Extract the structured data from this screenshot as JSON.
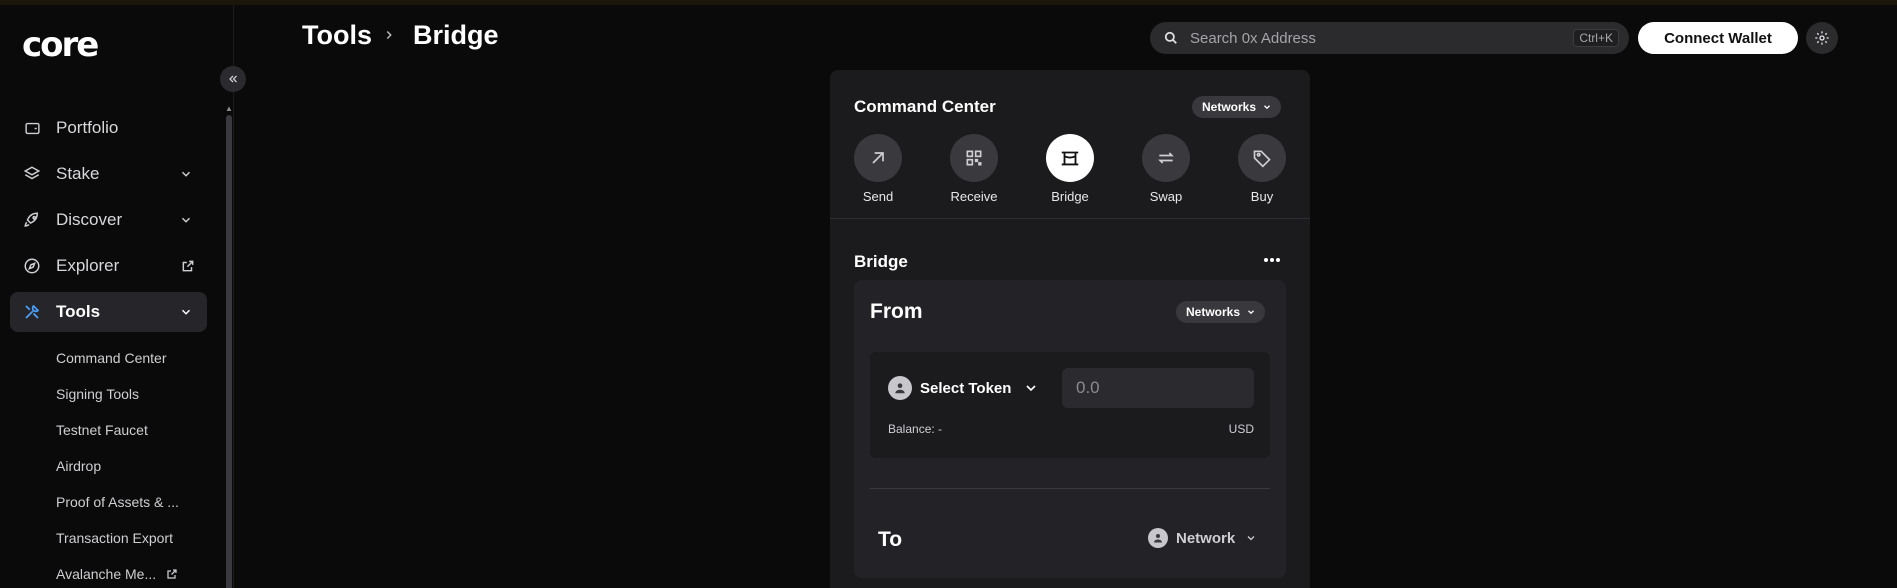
{
  "app": {
    "logo": "core"
  },
  "sidebar": {
    "items": [
      {
        "label": "Portfolio"
      },
      {
        "label": "Stake"
      },
      {
        "label": "Discover"
      },
      {
        "label": "Explorer"
      },
      {
        "label": "Tools"
      }
    ],
    "tools_subitems": [
      {
        "label": "Command Center"
      },
      {
        "label": "Signing Tools"
      },
      {
        "label": "Testnet Faucet"
      },
      {
        "label": "Airdrop"
      },
      {
        "label": "Proof of Assets & ..."
      },
      {
        "label": "Transaction Export"
      },
      {
        "label": "Avalanche Me..."
      }
    ]
  },
  "header": {
    "breadcrumb": [
      "Tools",
      "Bridge"
    ],
    "search_placeholder": "Search 0x Address",
    "search_shortcut": "Ctrl+K",
    "connect_label": "Connect Wallet"
  },
  "command_center": {
    "title": "Command Center",
    "networks_label": "Networks",
    "actions": [
      {
        "label": "Send",
        "icon": "arrow-up-right-icon"
      },
      {
        "label": "Receive",
        "icon": "qr-code-icon"
      },
      {
        "label": "Bridge",
        "icon": "bridge-icon",
        "active": true
      },
      {
        "label": "Swap",
        "icon": "swap-arrows-icon"
      },
      {
        "label": "Buy",
        "icon": "tag-icon"
      }
    ]
  },
  "bridge": {
    "title": "Bridge",
    "from_label": "From",
    "from_networks_label": "Networks",
    "select_token_label": "Select Token",
    "amount_placeholder": "0.0",
    "balance_label": "Balance: -",
    "currency": "USD",
    "to_label": "To",
    "to_network_label": "Network"
  },
  "colors": {
    "background": "#0a0a0b",
    "panel": "#1b1b1e",
    "accent_blue": "#4ba3ff"
  }
}
